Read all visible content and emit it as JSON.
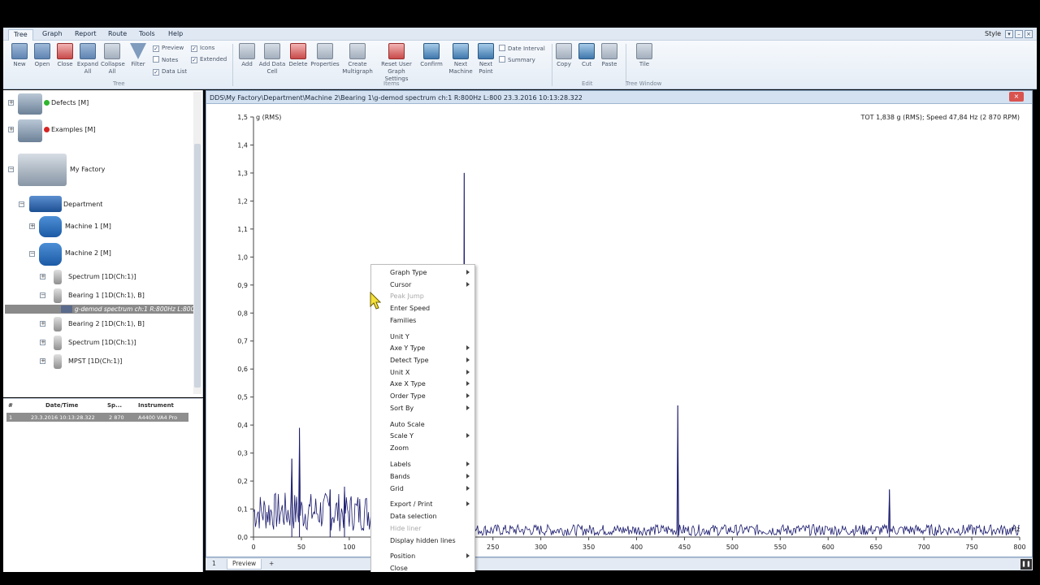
{
  "menubar": {
    "tabs": [
      "Tree",
      "Graph",
      "Report",
      "Route",
      "Tools",
      "Help"
    ],
    "style_label": "Style"
  },
  "ribbon": {
    "tree_buttons": [
      {
        "label": "New",
        "icon": "new-file-icon"
      },
      {
        "label": "Open",
        "icon": "open-folder-icon"
      },
      {
        "label": "Close",
        "icon": "close-folder-icon"
      },
      {
        "label": "Expand\nAll",
        "icon": "expand-all-icon"
      },
      {
        "label": "Collapse\nAll",
        "icon": "collapse-all-icon"
      },
      {
        "label": "Filter",
        "icon": "filter-icon"
      }
    ],
    "tree_checks": [
      {
        "label": "Preview",
        "checked": true
      },
      {
        "label": "Notes",
        "checked": false
      },
      {
        "label": "Data List",
        "checked": true
      },
      {
        "label": "Icons",
        "checked": true
      },
      {
        "label": "Extended",
        "checked": true
      }
    ],
    "tree_group": "Tree",
    "item_buttons": [
      {
        "label": "Add",
        "icon": "add-icon"
      },
      {
        "label": "Add Data\nCell",
        "icon": "add-data-cell-icon"
      },
      {
        "label": "Delete",
        "icon": "delete-icon"
      },
      {
        "label": "Properties",
        "icon": "properties-icon"
      },
      {
        "label": "Create\nMultigraph",
        "icon": "multigraph-icon"
      },
      {
        "label": "Reset User\nGraph Settings",
        "icon": "reset-settings-icon"
      },
      {
        "label": "Confirm",
        "icon": "confirm-icon"
      },
      {
        "label": "Next\nMachine",
        "icon": "next-machine-icon"
      },
      {
        "label": "Next\nPoint",
        "icon": "next-point-icon"
      }
    ],
    "item_checks": [
      {
        "label": "Date Interval",
        "checked": false
      },
      {
        "label": "Summary",
        "checked": false
      }
    ],
    "items_group": "Items",
    "edit_buttons": [
      {
        "label": "Copy",
        "icon": "copy-icon"
      },
      {
        "label": "Cut",
        "icon": "cut-icon"
      },
      {
        "label": "Paste",
        "icon": "paste-icon"
      }
    ],
    "edit_group": "Edit",
    "tile_button": "Tile",
    "tree_window_group": "Tree Window"
  },
  "tree": {
    "nodes": [
      {
        "label": "Defects [M]",
        "status_color": "#2fb52f"
      },
      {
        "label": "Examples [M]",
        "status_color": "#d62424"
      },
      {
        "label": "My Factory"
      },
      {
        "label": "Department"
      },
      {
        "label": "Machine 1 [M]"
      },
      {
        "label": "Machine 2 [M]"
      },
      {
        "label": "Spectrum [1D(Ch:1)]"
      },
      {
        "label": "Bearing 1 [1D(Ch:1), B]"
      },
      {
        "label": "g-demod spectrum ch:1 R:800Hz L:800"
      },
      {
        "label": "Bearing 2 [1D(Ch:1), B]"
      },
      {
        "label": "Spectrum [1D(Ch:1)]"
      },
      {
        "label": "MPST [1D(Ch:1)]"
      }
    ]
  },
  "datalist": {
    "headers": [
      "#",
      "Date/Time",
      "Sp...",
      "Instrument"
    ],
    "rows": [
      [
        "1",
        "23.3.2016 10:13:28.322",
        "2 870",
        "A4400 VA4 Pro"
      ]
    ]
  },
  "chart_window": {
    "path": "DDS\\My Factory\\Department\\Machine 2\\Bearing 1\\g-demod spectrum ch:1 R:800Hz L:800      23.3.2016 10:13:28.322"
  },
  "bottom_tabs": [
    "1",
    "Preview",
    "+"
  ],
  "chart_data": {
    "type": "line",
    "ylabel": "g (RMS)",
    "xlabel": "Hz",
    "info": "TOT 1,838 g (RMS); Speed 47,84 Hz (2 870 RPM)",
    "xlim": [
      0,
      800
    ],
    "ylim": [
      0,
      1.5
    ],
    "xticks": [
      0,
      50,
      100,
      150,
      200,
      250,
      300,
      350,
      400,
      450,
      500,
      550,
      600,
      650,
      700,
      750,
      800
    ],
    "yticks": [
      "0.0",
      "0.1",
      "0.2",
      "0.3",
      "0.4",
      "0.5",
      "0.6",
      "0.7",
      "0.8",
      "0.9",
      "1.0",
      "1.1",
      "1.2",
      "1.3",
      "1.4",
      "1.5"
    ],
    "line_color": "#1a1a6e",
    "peaks": [
      {
        "x": 40,
        "y": 0.28
      },
      {
        "x": 48,
        "y": 0.39
      },
      {
        "x": 80,
        "y": 0.17
      },
      {
        "x": 95,
        "y": 0.18
      },
      {
        "x": 220,
        "y": 1.3
      },
      {
        "x": 443,
        "y": 0.47
      },
      {
        "x": 664,
        "y": 0.17
      }
    ],
    "noise_level": 0.04
  },
  "context_menu": {
    "items": [
      {
        "label": "Graph Type",
        "submenu": true
      },
      {
        "label": "Cursor",
        "submenu": true
      },
      {
        "label": "Peak Jump",
        "disabled": true
      },
      {
        "label": "Enter Speed"
      },
      {
        "label": "Families"
      },
      {
        "label": "Unit Y"
      },
      {
        "label": "Axe Y Type",
        "submenu": true
      },
      {
        "label": "Detect Type",
        "submenu": true
      },
      {
        "label": "Unit X",
        "submenu": true
      },
      {
        "label": "Axe X Type",
        "submenu": true
      },
      {
        "label": "Order Type",
        "submenu": true
      },
      {
        "label": "Sort By",
        "submenu": true
      },
      {
        "label": "Auto Scale"
      },
      {
        "label": "Scale Y",
        "submenu": true
      },
      {
        "label": "Zoom"
      },
      {
        "label": "Labels",
        "submenu": true
      },
      {
        "label": "Bands",
        "submenu": true
      },
      {
        "label": "Grid",
        "submenu": true
      },
      {
        "label": "Export / Print",
        "submenu": true
      },
      {
        "label": "Data selection"
      },
      {
        "label": "Hide liner",
        "disabled": true
      },
      {
        "label": "Display hidden lines"
      },
      {
        "label": "Position",
        "submenu": true
      },
      {
        "label": "Close"
      }
    ]
  }
}
